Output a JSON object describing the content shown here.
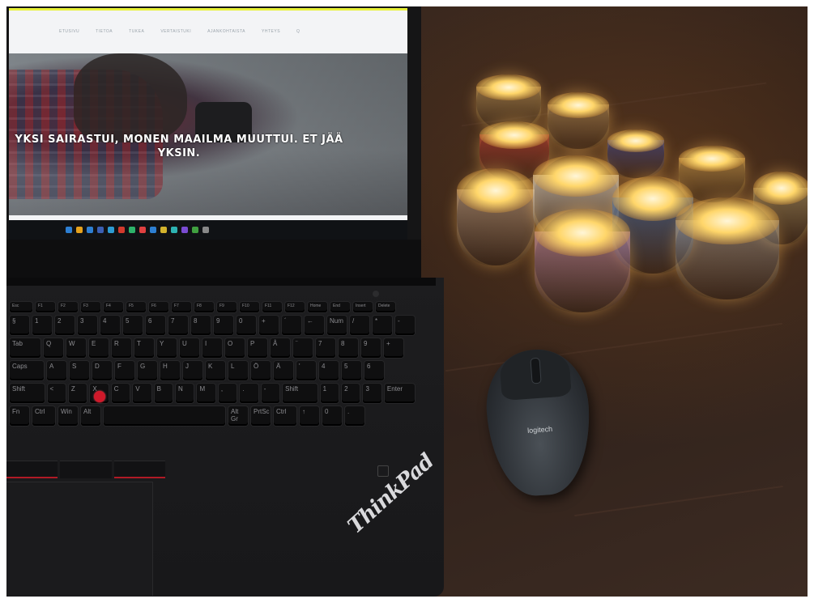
{
  "screen": {
    "nav_items": [
      "ETUSIVU",
      "TIETOA",
      "TUKEA",
      "VERTAISTUKI",
      "AJANKOHTAISTA",
      "YHTEYS",
      "Q"
    ],
    "hero_title": "YKSI SAIRASTUI, MONEN MAAILMA MUUTTUI. ET JÄÄ YKSIN."
  },
  "laptop": {
    "brand": "ThinkPad",
    "accent_color": "#d0192a"
  },
  "mouse": {
    "brand": "logitech"
  },
  "keyboard": {
    "rows": [
      [
        "Esc",
        "F1",
        "F2",
        "F3",
        "F4",
        "F5",
        "F6",
        "F7",
        "F8",
        "F9",
        "F10",
        "F11",
        "F12",
        "Home",
        "End",
        "Insert",
        "Delete"
      ],
      [
        "§",
        "1",
        "2",
        "3",
        "4",
        "5",
        "6",
        "7",
        "8",
        "9",
        "0",
        "+",
        "´",
        "←",
        "Num",
        "/",
        "*",
        "-"
      ],
      [
        "Tab",
        "Q",
        "W",
        "E",
        "R",
        "T",
        "Y",
        "U",
        "I",
        "O",
        "P",
        "Å",
        "¨",
        "7",
        "8",
        "9",
        "+"
      ],
      [
        "Caps",
        "A",
        "S",
        "D",
        "F",
        "G",
        "H",
        "J",
        "K",
        "L",
        "Ö",
        "Ä",
        "'",
        "4",
        "5",
        "6"
      ],
      [
        "Shift",
        "<",
        "Z",
        "X",
        "C",
        "V",
        "B",
        "N",
        "M",
        ",",
        ".",
        "-",
        "Shift",
        "1",
        "2",
        "3",
        "Enter"
      ],
      [
        "Fn",
        "Ctrl",
        "Win",
        "Alt",
        "",
        "Alt Gr",
        "PrtSc",
        "Ctrl",
        "↑",
        "0",
        "."
      ]
    ]
  }
}
